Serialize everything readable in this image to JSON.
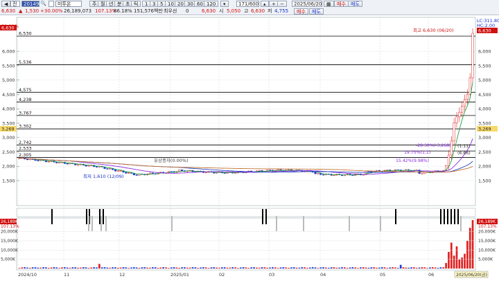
{
  "toolbar": {
    "row1": {
      "arrow_label": "",
      "mode_label": "전",
      "stock_code": "201490",
      "stock_name": "미투온",
      "period_buttons": [
        "주",
        "월",
        "년",
        "분",
        "초",
        "틱"
      ],
      "minute_buttons": [
        "1",
        "3",
        "5",
        "10",
        "20",
        "30",
        "60",
        "120"
      ],
      "bar_count": "171/600",
      "date": "2025/06/20",
      "buy_label": "매수",
      "sell_label": "매도"
    },
    "row2": {
      "price": "6,630",
      "change": "1,530",
      "change_pct": "+30.00%",
      "volume": "26,189,073",
      "vol_ratio": "107.13%",
      "turnover": "86.18%",
      "amount": "151,576백만",
      "label_low_pref": "최우선",
      "pref_value": "0",
      "open_price": "6,630",
      "open_label": "시",
      "open_value": "5,050",
      "high_label": "고",
      "high_value": "6,630",
      "low_label": "저",
      "low_value": "4,755"
    }
  },
  "chart": {
    "colors": {
      "up": "#e02020",
      "down": "#1a40d0",
      "ma1": "#2040c0",
      "ma2": "#c07030",
      "ma3": "#8a2be2",
      "ma4": "#20a040",
      "line": "#000000"
    },
    "left_top_labels": [
      "6,630",
      "30.00%"
    ],
    "right_top_labels": [
      "LC:311.80",
      "HC:2.00"
    ],
    "right_price_tag": "6,630",
    "right_tag_3269": "3,269",
    "left_tag_3269": "3,269",
    "annotations": {
      "high": "최고 6,630 (06/20)",
      "low": "최저 1,610 (12/09)",
      "event": "유상증자(0.00%)",
      "pct1": "-28.30%(-3,268)",
      "pct2": "19.75%(1,1)",
      "pct3": "15.42%(9.98%)",
      "pct4": "(6.66)",
      "pct5": "(1.11)"
    },
    "price_axis": [
      "6,000",
      "5,500",
      "5,000",
      "4,500",
      "4,000",
      "3,500",
      "3,000",
      "2,500",
      "2,000",
      "1,500"
    ],
    "h_levels": [
      {
        "label": "6,530",
        "value": 6530
      },
      {
        "label": "5,536",
        "value": 5536
      },
      {
        "label": "4,575",
        "value": 4575
      },
      {
        "label": "4,238",
        "value": 4238
      },
      {
        "label": "3,767",
        "value": 3767
      },
      {
        "label": "3,302",
        "value": 3302
      },
      {
        "label": "2,742",
        "value": 2742
      },
      {
        "label": "2,533",
        "value": 2533
      },
      {
        "label": "2,305",
        "value": 2305
      }
    ],
    "volume_axis": [
      "20,000K",
      "15,000K",
      "10,000K",
      "5,000K"
    ],
    "volume_top_left": [
      "26,189K",
      "107.13%"
    ],
    "volume_top_right": [
      "26,189K",
      "107.13%"
    ],
    "volume_right_axis": [
      "20,000K",
      "15,000K",
      "10,000K",
      "5,000K"
    ],
    "date_axis": [
      "2024/10",
      "11",
      "12",
      "2025/01",
      "02",
      "03",
      "04",
      "05",
      "06"
    ],
    "last_date_tag": "2025/06/20(금)"
  }
}
